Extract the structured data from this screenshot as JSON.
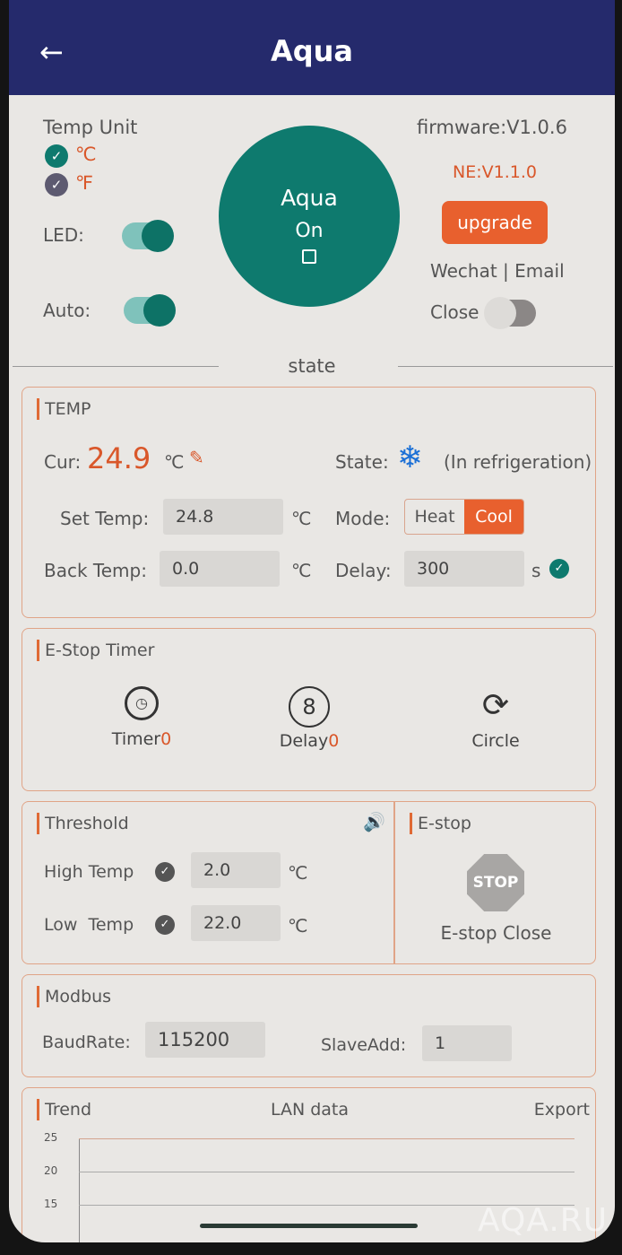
{
  "header": {
    "title": "Aqua",
    "back_icon": "arrow-left-icon"
  },
  "top": {
    "temp_unit_label": "Temp Unit",
    "celsius": "℃",
    "fahrenheit": "℉",
    "celsius_checked": true,
    "led_label": "LED:",
    "led_on": true,
    "auto_label": "Auto:",
    "auto_on": true,
    "device_name": "Aqua",
    "device_state": "On",
    "firmware": "firmware:V1.0.6",
    "ne_version": "NE:V1.1.0",
    "upgrade_label": "upgrade",
    "contact": "Wechat | Email",
    "close_label": "Close",
    "close_on": false
  },
  "section_state": "state",
  "temp": {
    "title": "TEMP",
    "cur_label": "Cur:",
    "cur_value": "24.9",
    "unit": "℃",
    "state_label": "State:",
    "state_value": "(In refrigeration)",
    "set_label": "Set Temp:",
    "set_value": "24.8",
    "mode_label": "Mode:",
    "mode_options": [
      "Heat",
      "Cool"
    ],
    "mode_selected": "Cool",
    "back_label": "Back Temp:",
    "back_value": "0.0",
    "delay_label": "Delay:",
    "delay_value": "300",
    "delay_unit": "s"
  },
  "estop_timer": {
    "title": "E-Stop Timer",
    "timer_label": "Timer",
    "timer_count": "0",
    "delay_label": "Delay",
    "delay_count": "0",
    "circle_label": "Circle"
  },
  "threshold": {
    "title": "Threshold",
    "high_label": "High Temp",
    "high_value": "2.0",
    "low_label": "Low  Temp",
    "low_value": "22.0",
    "unit": "℃"
  },
  "estop": {
    "title": "E-stop",
    "stop_text": "STOP",
    "status": "E-stop Close"
  },
  "modbus": {
    "title": "Modbus",
    "baud_label": "BaudRate:",
    "baud_value": "115200",
    "slave_label": "SlaveAdd:",
    "slave_value": "1"
  },
  "trend": {
    "title": "Trend",
    "subtitle": "LAN data",
    "export_label": "Export",
    "y_ticks": [
      "25",
      "20",
      "15"
    ]
  },
  "colors": {
    "header": "#252a6c",
    "accent": "#0e7a6e",
    "orange": "#e8602e"
  },
  "watermark": "AQA.RU"
}
